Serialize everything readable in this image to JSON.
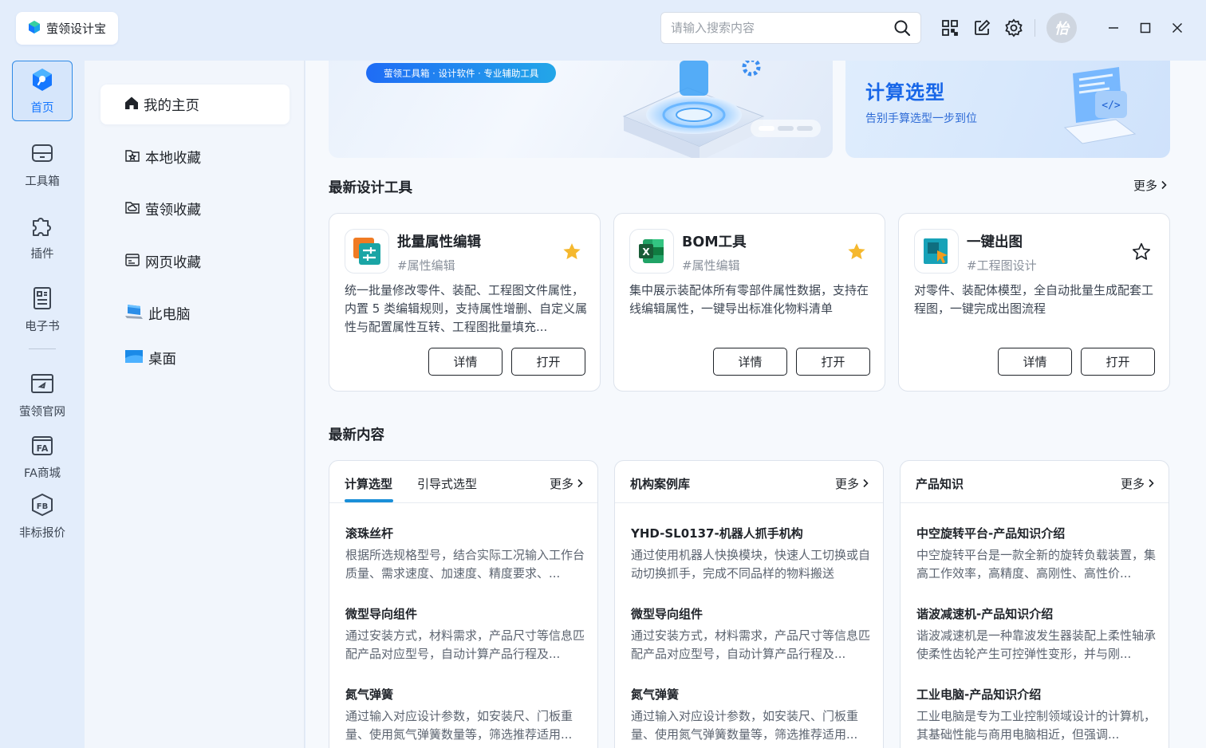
{
  "app": {
    "name": "萤领设计宝"
  },
  "search": {
    "placeholder": "请输入搜索内容"
  },
  "topbar": {
    "icons": [
      "search-icon",
      "qrcode-icon",
      "edit-icon",
      "gear-icon",
      "avatar",
      "minimize-icon",
      "maximize-icon",
      "close-icon"
    ],
    "avatar_text": "怡"
  },
  "rail": {
    "items": [
      {
        "label": "首页",
        "icon": "home-cube-icon",
        "active": true
      },
      {
        "label": "工具箱",
        "icon": "toolbox-icon"
      },
      {
        "label": "插件",
        "icon": "puzzle-icon"
      },
      {
        "label": "电子书",
        "icon": "ebook-icon"
      },
      {
        "label": "萤领官网",
        "icon": "website-icon"
      },
      {
        "label": "FA商城",
        "icon": "fa-store-icon"
      },
      {
        "label": "非标报价",
        "icon": "fb-quote-icon"
      }
    ]
  },
  "subnav": {
    "items": [
      {
        "label": "我的主页",
        "icon": "home-icon",
        "active": true
      },
      {
        "label": "本地收藏",
        "icon": "local-favorite-icon"
      },
      {
        "label": "萤领收藏",
        "icon": "cloud-favorite-icon"
      },
      {
        "label": "网页收藏",
        "icon": "web-favorite-icon"
      },
      {
        "label": "此电脑",
        "icon": "computer-icon"
      },
      {
        "label": "桌面",
        "icon": "desktop-icon"
      }
    ]
  },
  "banner": {
    "left_pill": "萤领工具箱 · 设计软件 · 专业辅助工具",
    "right_title": "计算选型",
    "right_subtitle": "告别手算选型一步到位"
  },
  "tools_section": {
    "title": "最新设计工具",
    "more": "更多",
    "cards": [
      {
        "name": "批量属性编辑",
        "tag": "#属性编辑",
        "starred": true,
        "desc": "统一批量修改零件、装配、工程图文件属性，内置 5 类编辑规则，支持属性增删、自定义属性与配置属性互转、工程图批量填充...",
        "details": "详情",
        "open": "打开"
      },
      {
        "name": "BOM工具",
        "tag": "#属性编辑",
        "starred": true,
        "desc": "集中展示装配体所有零部件属性数据，支持在线编辑属性，一键导出标准化物料清单",
        "details": "详情",
        "open": "打开"
      },
      {
        "name": "一键出图",
        "tag": "#工程图设计",
        "starred": false,
        "desc": "对零件、装配体模型，全自动批量生成配套工程图，一键完成出图流程",
        "details": "详情",
        "open": "打开"
      }
    ]
  },
  "content_section": {
    "title": "最新内容",
    "cards": [
      {
        "tabs": [
          "计算选型",
          "引导式选型"
        ],
        "more": "更多",
        "items": [
          {
            "title": "滚珠丝杆",
            "desc": "根据所选规格型号，结合实际工况输入工作台质量、需求速度、加速度、精度要求、..."
          },
          {
            "title": "微型导向组件",
            "desc": "通过安装方式，材料需求，产品尺寸等信息匹配产品对应型号，自动计算产品行程及..."
          },
          {
            "title": "氮气弹簧",
            "desc": "通过输入对应设计参数，如安装尺、门板重量、使用氮气弹簧数量等，筛选推荐适用..."
          }
        ]
      },
      {
        "tabs": [
          "机构案例库"
        ],
        "more": "更多",
        "items": [
          {
            "title": "YHD-SL0137-机器人抓手机构",
            "desc": "通过使用机器人快换模块，快速人工切换或自动切换抓手，完成不同品样的物料搬送"
          },
          {
            "title": "微型导向组件",
            "desc": "通过安装方式，材料需求，产品尺寸等信息匹配产品对应型号，自动计算产品行程及..."
          },
          {
            "title": "氮气弹簧",
            "desc": "通过输入对应设计参数，如安装尺、门板重量、使用氮气弹簧数量等，筛选推荐适用..."
          }
        ]
      },
      {
        "tabs": [
          "产品知识"
        ],
        "more": "更多",
        "items": [
          {
            "title": "中空旋转平台-产品知识介绍",
            "desc": "中空旋转平台是一款全新的旋转负载装置，集高工作效率，高精度、高刚性、高性价..."
          },
          {
            "title": "谐波减速机-产品知识介绍",
            "desc": "谐波减速机是一种靠波发生器装配上柔性轴承使柔性齿轮产生可控弹性变形，并与刚..."
          },
          {
            "title": "工业电脑-产品知识介绍",
            "desc": "工业电脑是专为工业控制领域设计的计算机，其基础性能与商用电脑相近，但强调..."
          }
        ]
      }
    ]
  },
  "colors": {
    "accent": "#1677ff",
    "star": "#f5b82e",
    "underline": "#1a8fd8"
  }
}
